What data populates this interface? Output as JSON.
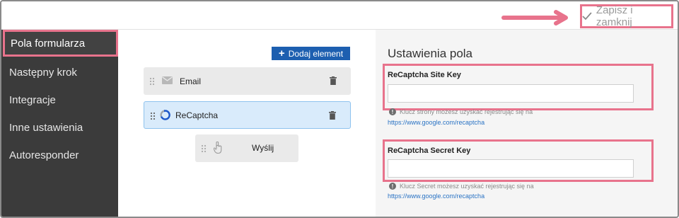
{
  "topbar": {
    "save_label": "Zapisz i zamknij",
    "annotation_color": "#e8738c"
  },
  "sidebar": {
    "items": [
      {
        "label": "Pola formularza",
        "active": true
      },
      {
        "label": "Następny krok"
      },
      {
        "label": "Integracje"
      },
      {
        "label": "Inne ustawienia"
      },
      {
        "label": "Autoresponder"
      }
    ]
  },
  "form_fields": {
    "add_button_label": "Dodaj element",
    "rows": [
      {
        "label": "Email",
        "icon": "envelope-icon"
      },
      {
        "label": "ReCaptcha",
        "icon": "recaptcha-icon",
        "selected": true
      },
      {
        "label": "Wyślij",
        "icon": "hand-pointer-icon"
      }
    ]
  },
  "settings": {
    "title": "Ustawienia pola",
    "site_key": {
      "label": "ReCaptcha Site Key",
      "value": "",
      "hint": "Klucz strony możesz uzyskać rejestrując się na",
      "link": "https://www.google.com/recaptcha"
    },
    "secret_key": {
      "label": "ReCaptcha Secret Key",
      "value": "",
      "hint": "Klucz Secret możesz uzyskać rejestrując się na",
      "link": "https://www.google.com/recaptcha"
    }
  },
  "colors": {
    "accent": "#1d5fb0",
    "sidebar_bg": "#3b3b3b",
    "highlight": "#e8738c",
    "selected_row": "#d9ebfb"
  }
}
